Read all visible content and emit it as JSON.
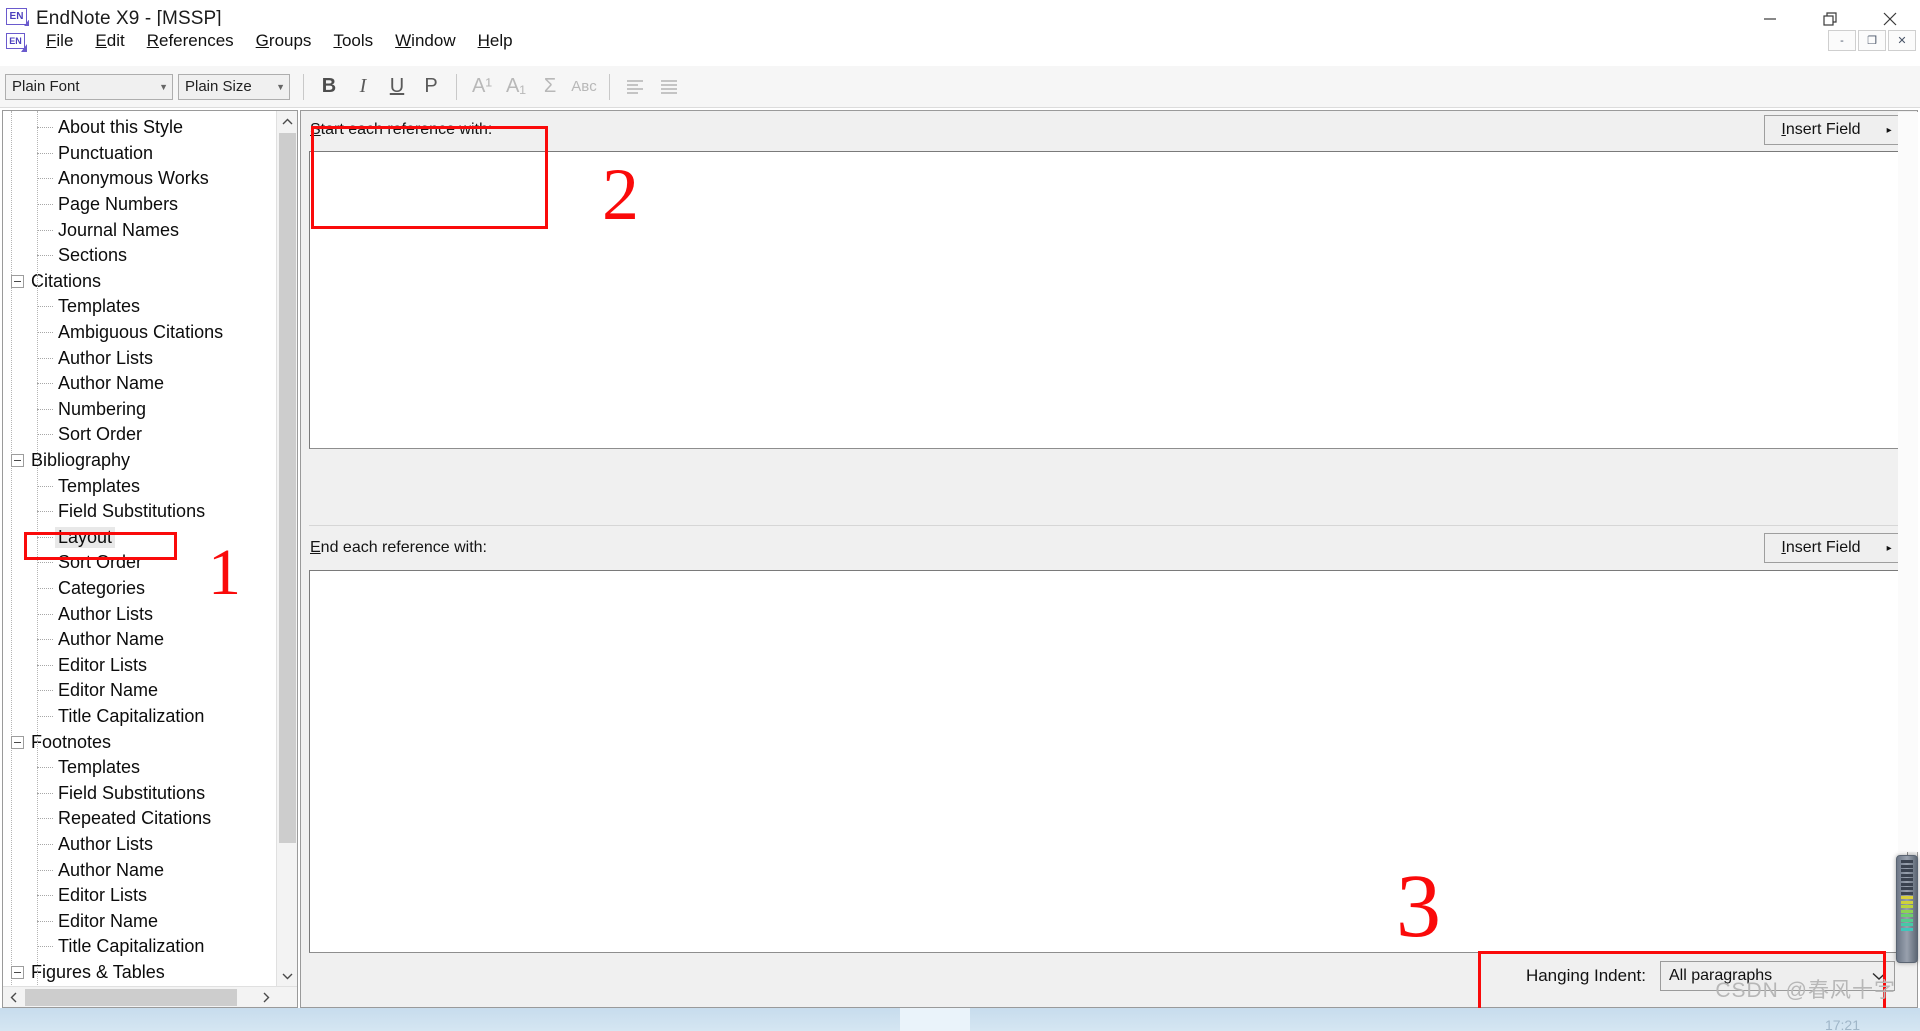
{
  "window": {
    "title": "EndNote X9 - [MSSP]",
    "app_icon": "endnote-icon",
    "minimize": "minimize-icon",
    "maximize": "restore-icon",
    "close": "close-icon"
  },
  "menu": {
    "icon": "endnote-icon",
    "items": [
      {
        "label": "File",
        "mnemonic": "F"
      },
      {
        "label": "Edit",
        "mnemonic": "E"
      },
      {
        "label": "References",
        "mnemonic": "R"
      },
      {
        "label": "Groups",
        "mnemonic": "G"
      },
      {
        "label": "Tools",
        "mnemonic": "T"
      },
      {
        "label": "Window",
        "mnemonic": "W"
      },
      {
        "label": "Help",
        "mnemonic": "H"
      }
    ],
    "mdi": {
      "minimize": "-",
      "restore": "❐",
      "close": "✕"
    }
  },
  "toolbar": {
    "font_combo": {
      "value": "Plain Font",
      "arrow": "chevron-down-icon"
    },
    "size_combo": {
      "value": "Plain Size",
      "arrow": "chevron-down-icon"
    },
    "buttons": [
      {
        "name": "bold-button",
        "glyph": "B"
      },
      {
        "name": "italic-button",
        "glyph": "I"
      },
      {
        "name": "underline-button",
        "glyph": "U"
      },
      {
        "name": "plain-button",
        "glyph": "P"
      },
      {
        "name": "superscript-button",
        "glyph": "A¹"
      },
      {
        "name": "subscript-button",
        "glyph": "A₁"
      },
      {
        "name": "insert-symbol-button",
        "glyph": "Σ"
      },
      {
        "name": "abbreviation-button",
        "glyph": "Aʙс"
      },
      {
        "name": "align-left-button",
        "glyph": "align-left-icon"
      },
      {
        "name": "align-justify-button",
        "glyph": "align-justify-icon"
      }
    ]
  },
  "tree": {
    "items": [
      {
        "label": "About this Style",
        "level": 1,
        "expander": false,
        "selected": false
      },
      {
        "label": "Punctuation",
        "level": 1,
        "expander": false,
        "selected": false
      },
      {
        "label": "Anonymous Works",
        "level": 1,
        "expander": false,
        "selected": false
      },
      {
        "label": "Page Numbers",
        "level": 1,
        "expander": false,
        "selected": false
      },
      {
        "label": "Journal Names",
        "level": 1,
        "expander": false,
        "selected": false
      },
      {
        "label": "Sections",
        "level": 1,
        "expander": false,
        "selected": false
      },
      {
        "label": "Citations",
        "level": 0,
        "expander": true,
        "selected": false
      },
      {
        "label": "Templates",
        "level": 2,
        "expander": false,
        "selected": false
      },
      {
        "label": "Ambiguous Citations",
        "level": 2,
        "expander": false,
        "selected": false
      },
      {
        "label": "Author Lists",
        "level": 2,
        "expander": false,
        "selected": false
      },
      {
        "label": "Author Name",
        "level": 2,
        "expander": false,
        "selected": false
      },
      {
        "label": "Numbering",
        "level": 2,
        "expander": false,
        "selected": false
      },
      {
        "label": "Sort Order",
        "level": 2,
        "expander": false,
        "selected": false
      },
      {
        "label": "Bibliography",
        "level": 0,
        "expander": true,
        "selected": false
      },
      {
        "label": "Templates",
        "level": 2,
        "expander": false,
        "selected": false
      },
      {
        "label": "Field Substitutions",
        "level": 2,
        "expander": false,
        "selected": false
      },
      {
        "label": "Layout",
        "level": 2,
        "expander": false,
        "selected": true
      },
      {
        "label": "Sort Order",
        "level": 2,
        "expander": false,
        "selected": false
      },
      {
        "label": "Categories",
        "level": 2,
        "expander": false,
        "selected": false
      },
      {
        "label": "Author Lists",
        "level": 2,
        "expander": false,
        "selected": false
      },
      {
        "label": "Author Name",
        "level": 2,
        "expander": false,
        "selected": false
      },
      {
        "label": "Editor Lists",
        "level": 2,
        "expander": false,
        "selected": false
      },
      {
        "label": "Editor Name",
        "level": 2,
        "expander": false,
        "selected": false
      },
      {
        "label": "Title Capitalization",
        "level": 2,
        "expander": false,
        "selected": false
      },
      {
        "label": "Footnotes",
        "level": 0,
        "expander": true,
        "selected": false
      },
      {
        "label": "Templates",
        "level": 2,
        "expander": false,
        "selected": false
      },
      {
        "label": "Field Substitutions",
        "level": 2,
        "expander": false,
        "selected": false
      },
      {
        "label": "Repeated Citations",
        "level": 2,
        "expander": false,
        "selected": false
      },
      {
        "label": "Author Lists",
        "level": 2,
        "expander": false,
        "selected": false
      },
      {
        "label": "Author Name",
        "level": 2,
        "expander": false,
        "selected": false
      },
      {
        "label": "Editor Lists",
        "level": 2,
        "expander": false,
        "selected": false
      },
      {
        "label": "Editor Name",
        "level": 2,
        "expander": false,
        "selected": false
      },
      {
        "label": "Title Capitalization",
        "level": 2,
        "expander": false,
        "selected": false
      },
      {
        "label": "Figures & Tables",
        "level": 0,
        "expander": true,
        "selected": false
      }
    ],
    "scroll_up": "scroll-up-icon",
    "scroll_down": "scroll-down-icon",
    "scroll_left": "scroll-left-icon",
    "scroll_right": "scroll-right-icon"
  },
  "main": {
    "start_section": {
      "label": "Start each reference with:",
      "mnemonic": "S",
      "value": "",
      "insert_field_label": "Insert Field",
      "insert_field_mnemonic": "I",
      "insert_field_caret": "▸"
    },
    "end_section": {
      "label": "End each reference with:",
      "mnemonic": "E",
      "value": "",
      "insert_field_label": "Insert Field",
      "insert_field_mnemonic": "I",
      "insert_field_caret": "▸"
    },
    "hanging_indent": {
      "label": "Hanging Indent:",
      "value": "All paragraphs",
      "chevron": "chevron-down-icon"
    }
  },
  "annotations": {
    "colors": {
      "marker": "#fa0a0a"
    },
    "marks": [
      {
        "id": "annot-1",
        "text": "1",
        "target": "Layout tree item"
      },
      {
        "id": "annot-2",
        "text": "2",
        "target": "Start each reference with"
      },
      {
        "id": "annot-3",
        "text": "3",
        "target": "Hanging Indent"
      }
    ]
  },
  "watermark": {
    "text": "CSDN @春风十字"
  },
  "taskbar": {
    "clock": "17:21"
  }
}
